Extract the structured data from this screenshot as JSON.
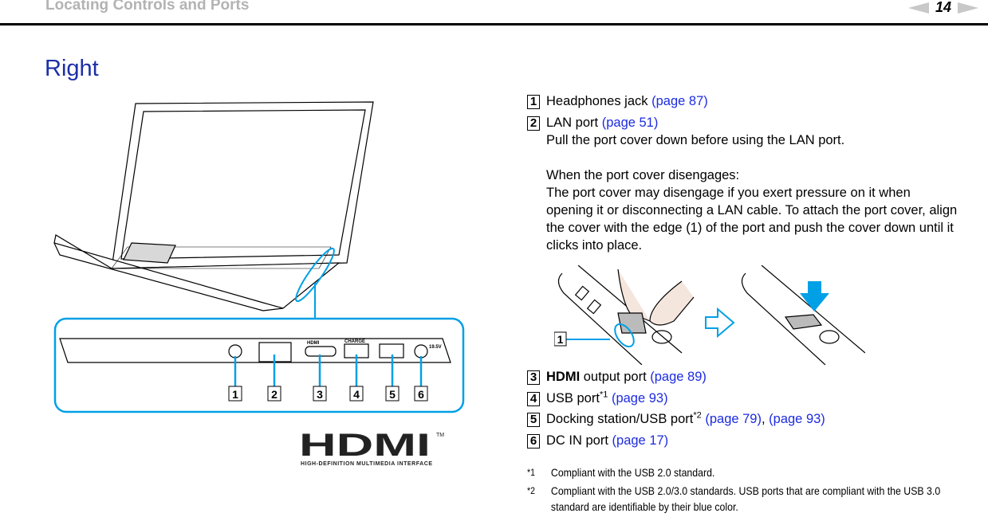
{
  "header": {
    "title": "Locating Controls and Ports",
    "page_number": "14",
    "prev_icon": "arrow-left-icon",
    "next_icon": "arrow-right-icon"
  },
  "section_title": "Right",
  "items": [
    {
      "num": "1",
      "label": "Headphones jack",
      "links": [
        "(page 87)"
      ]
    },
    {
      "num": "2",
      "label": "LAN port",
      "links": [
        "(page 51)"
      ],
      "desc": [
        "Pull the port cover down before using the LAN port.",
        "When the port cover disengages:",
        "The port cover may disengage if you exert pressure on it when opening it or disconnecting a LAN cable. To attach the port cover, align the cover with the edge (1) of the port and push the cover down until it clicks into place."
      ]
    },
    {
      "num": "3",
      "label_bold": "HDMI",
      "label": " output port",
      "links": [
        "(page 89)"
      ]
    },
    {
      "num": "4",
      "label": "USB port",
      "sup": "*1",
      "links": [
        "(page 93)"
      ]
    },
    {
      "num": "5",
      "label": "Docking station/USB port",
      "sup": "*2",
      "links": [
        "(page 79)",
        "(page 93)"
      ],
      "sep": ", "
    },
    {
      "num": "6",
      "label": "DC IN port",
      "links": [
        "(page 17)"
      ]
    }
  ],
  "footnotes": [
    {
      "mark": "*1",
      "text": "Compliant with the USB 2.0 standard."
    },
    {
      "mark": "*2",
      "text": "Compliant with the USB 2.0/3.0 standards. USB ports that are compliant with the USB 3.0 standard are identifiable by their blue color."
    }
  ],
  "figure_ports": {
    "callouts": [
      "1",
      "2",
      "3",
      "4",
      "5",
      "6"
    ],
    "port_labels": {
      "hdmi": "HDMI",
      "charge": "CHARGE",
      "dc": "19.5V"
    }
  },
  "figure_cover": {
    "callout": "1"
  },
  "hdmi_logo": {
    "mark": "HDMI",
    "tm": "TM",
    "tagline": "HIGH-DEFINITION MULTIMEDIA INTERFACE"
  },
  "colors": {
    "accent_blue": "#1c2fa8",
    "link_blue": "#1c2be0",
    "callout_cyan": "#00a0e6"
  }
}
